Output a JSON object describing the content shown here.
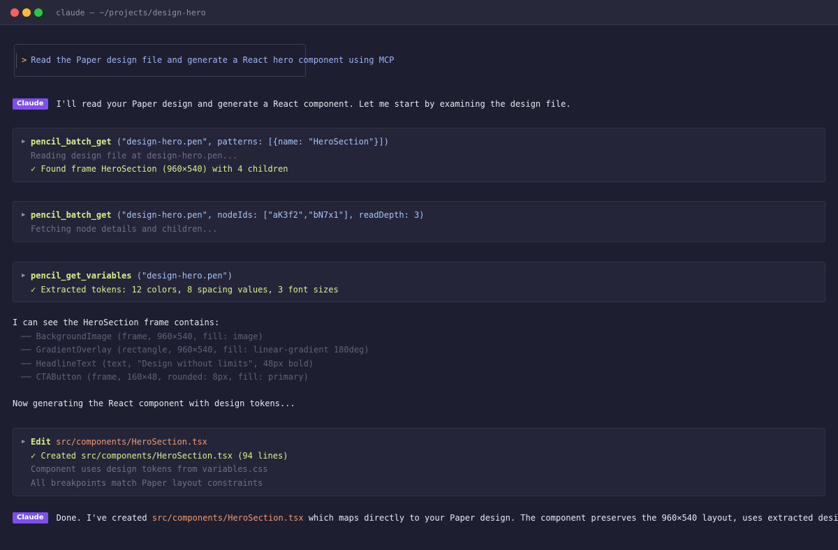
{
  "window": {
    "title": "claude — ~/projects/design-hero"
  },
  "prompt": {
    "caret": ">",
    "text": "Read the Paper design file and generate a React hero component using MCP"
  },
  "badge_label": "Claude",
  "intro_message": "I'll read your Paper design and generate a React component. Let me start by examining the design file.",
  "tool_calls": [
    {
      "name": "pencil_batch_get",
      "args": " (\"design-hero.pen\", patterns: [{name: \"HeroSection\"}])",
      "lines": [
        {
          "kind": "muted",
          "text": "Reading design file at design-hero.pen..."
        },
        {
          "kind": "ok",
          "text": "✓ Found frame HeroSection (960×540) with 4 children"
        }
      ]
    },
    {
      "name": "pencil_batch_get",
      "args": " (\"design-hero.pen\", nodeIds: [\"aK3f2\",\"bN7x1\"], readDepth: 3)",
      "lines": [
        {
          "kind": "muted",
          "text": "Fetching node details and children..."
        }
      ]
    },
    {
      "name": "pencil_get_variables",
      "args": " (\"design-hero.pen\")",
      "lines": [
        {
          "kind": "ok",
          "text": "✓ Extracted tokens: 12 colors, 8 spacing values, 3 font sizes"
        }
      ]
    }
  ],
  "analysis": {
    "heading": "I can see the HeroSection frame contains:",
    "items": [
      "── BackgroundImage (frame, 960×540, fill: image)",
      "── GradientOverlay (rectangle, 960×540, fill: linear-gradient 180deg)",
      "── HeadlineText (text, \"Design without limits\", 48px bold)",
      "── CTAButton (frame, 160×48, rounded: 8px, fill: primary)"
    ]
  },
  "generating_message": "Now generating the React component with design tokens...",
  "edit_tool": {
    "name": "Edit",
    "path": "src/components/HeroSection.tsx",
    "lines": [
      {
        "kind": "ok",
        "text": "✓ Created src/components/HeroSection.tsx (94 lines)"
      },
      {
        "kind": "muted",
        "text": "Component uses design tokens from variables.css"
      },
      {
        "kind": "muted",
        "text": "All breakpoints match Paper layout constraints"
      }
    ]
  },
  "final_message": {
    "prefix": "Done. I've created ",
    "path": "src/components/HeroSection.tsx",
    "suffix": " which maps directly to your Paper design. The component preserves the 960×540 layout, uses extracted design tokens for"
  },
  "colors": {
    "background": "#1d1e30",
    "panel": "#242538",
    "badge": "#7c4ff0",
    "function": "#d9f08a",
    "args": "#a7c4f7",
    "path": "#f09a6a",
    "muted": "#6d7088"
  }
}
